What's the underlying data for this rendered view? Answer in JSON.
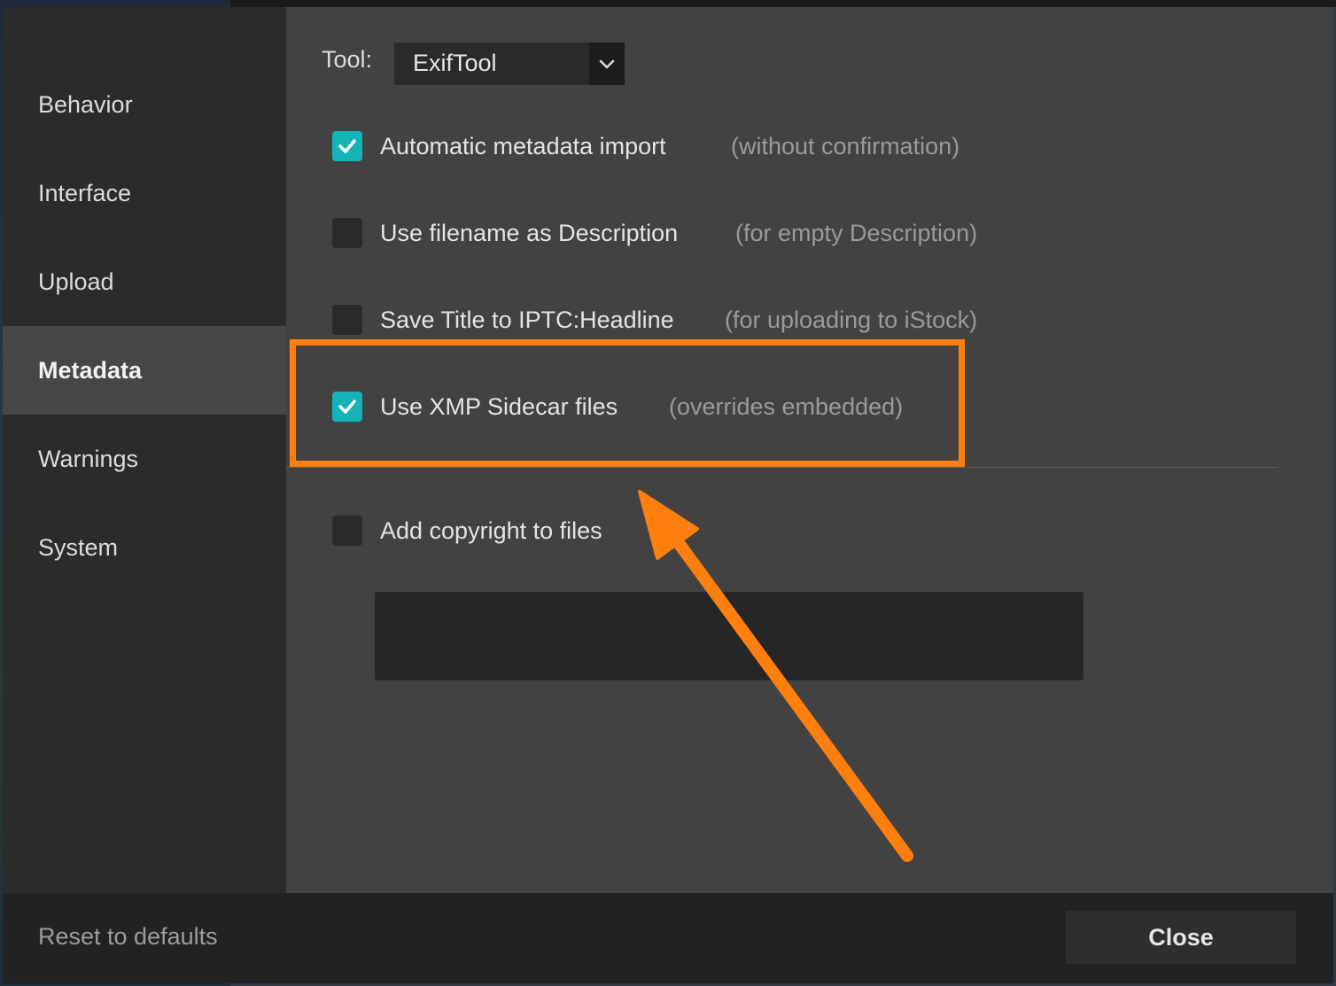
{
  "sidebar": {
    "items": [
      {
        "label": "Behavior",
        "active": false
      },
      {
        "label": "Interface",
        "active": false
      },
      {
        "label": "Upload",
        "active": false
      },
      {
        "label": "Metadata",
        "active": true
      },
      {
        "label": "Warnings",
        "active": false
      },
      {
        "label": "System",
        "active": false
      }
    ]
  },
  "tool": {
    "label": "Tool:",
    "selected": "ExifTool",
    "icon": "chevron-down-icon"
  },
  "options": [
    {
      "label": "Automatic metadata import",
      "hint": "(without confirmation)",
      "checked": true
    },
    {
      "label": "Use filename as Description",
      "hint": "(for empty Description)",
      "checked": false
    },
    {
      "label": "Save Title to IPTC:Headline",
      "hint": "(for uploading to iStock)",
      "checked": false
    },
    {
      "label": "Use XMP Sidecar files",
      "hint": "(overrides embedded)",
      "checked": true
    }
  ],
  "copyright": {
    "label": "Add copyright to files",
    "checked": false,
    "value": ""
  },
  "footer": {
    "reset_label": "Reset to defaults",
    "close_label": "Close"
  },
  "colors": {
    "accent": "#13b3b7",
    "annotation": "#ff7f0e"
  }
}
